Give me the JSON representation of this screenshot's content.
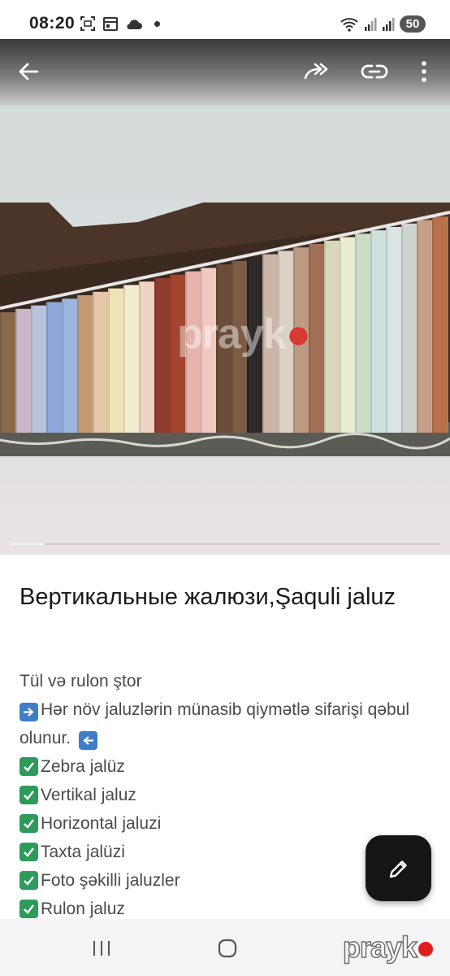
{
  "status_bar": {
    "time": "08:20",
    "battery": "50",
    "icons_left": [
      "screenshot-icon",
      "calendar-icon",
      "cloud-icon",
      "notification-dot-icon"
    ],
    "icons_right": [
      "wifi-icon",
      "signal-icon",
      "signal-icon",
      "battery-icon"
    ]
  },
  "app_bar": {
    "icons": [
      "back-arrow-icon",
      "share-forward-icon",
      "link-icon",
      "more-vert-icon"
    ]
  },
  "gallery": {
    "watermark_text": "prayk",
    "image_position_fraction": 0.08
  },
  "listing": {
    "title": "Вертикальные жалюзи,Şaquli jaluz",
    "intro": "Tül və rulon ştor",
    "line_offer": "Hər növ jaluzlərin münasib qiymətlə sifarişi qəbul olunur.",
    "features": [
      "Zebra jalüz",
      "Vertikal jaluz",
      "Horizontal jaluzi",
      "Taxta jalüzi",
      "Foto şəkilli jaluzler",
      "Rulon jaluz"
    ]
  },
  "fab": {
    "icon": "pencil-edit-icon"
  },
  "nav_bar": {
    "brand_text": "prayk",
    "icons": [
      "recent-apps-icon",
      "home-icon"
    ]
  },
  "colors": {
    "brand_red": "#d63a32",
    "fab_bg": "#161616",
    "check_green": "#2e9b5b",
    "arrow_blue": "#3e7ec8"
  }
}
